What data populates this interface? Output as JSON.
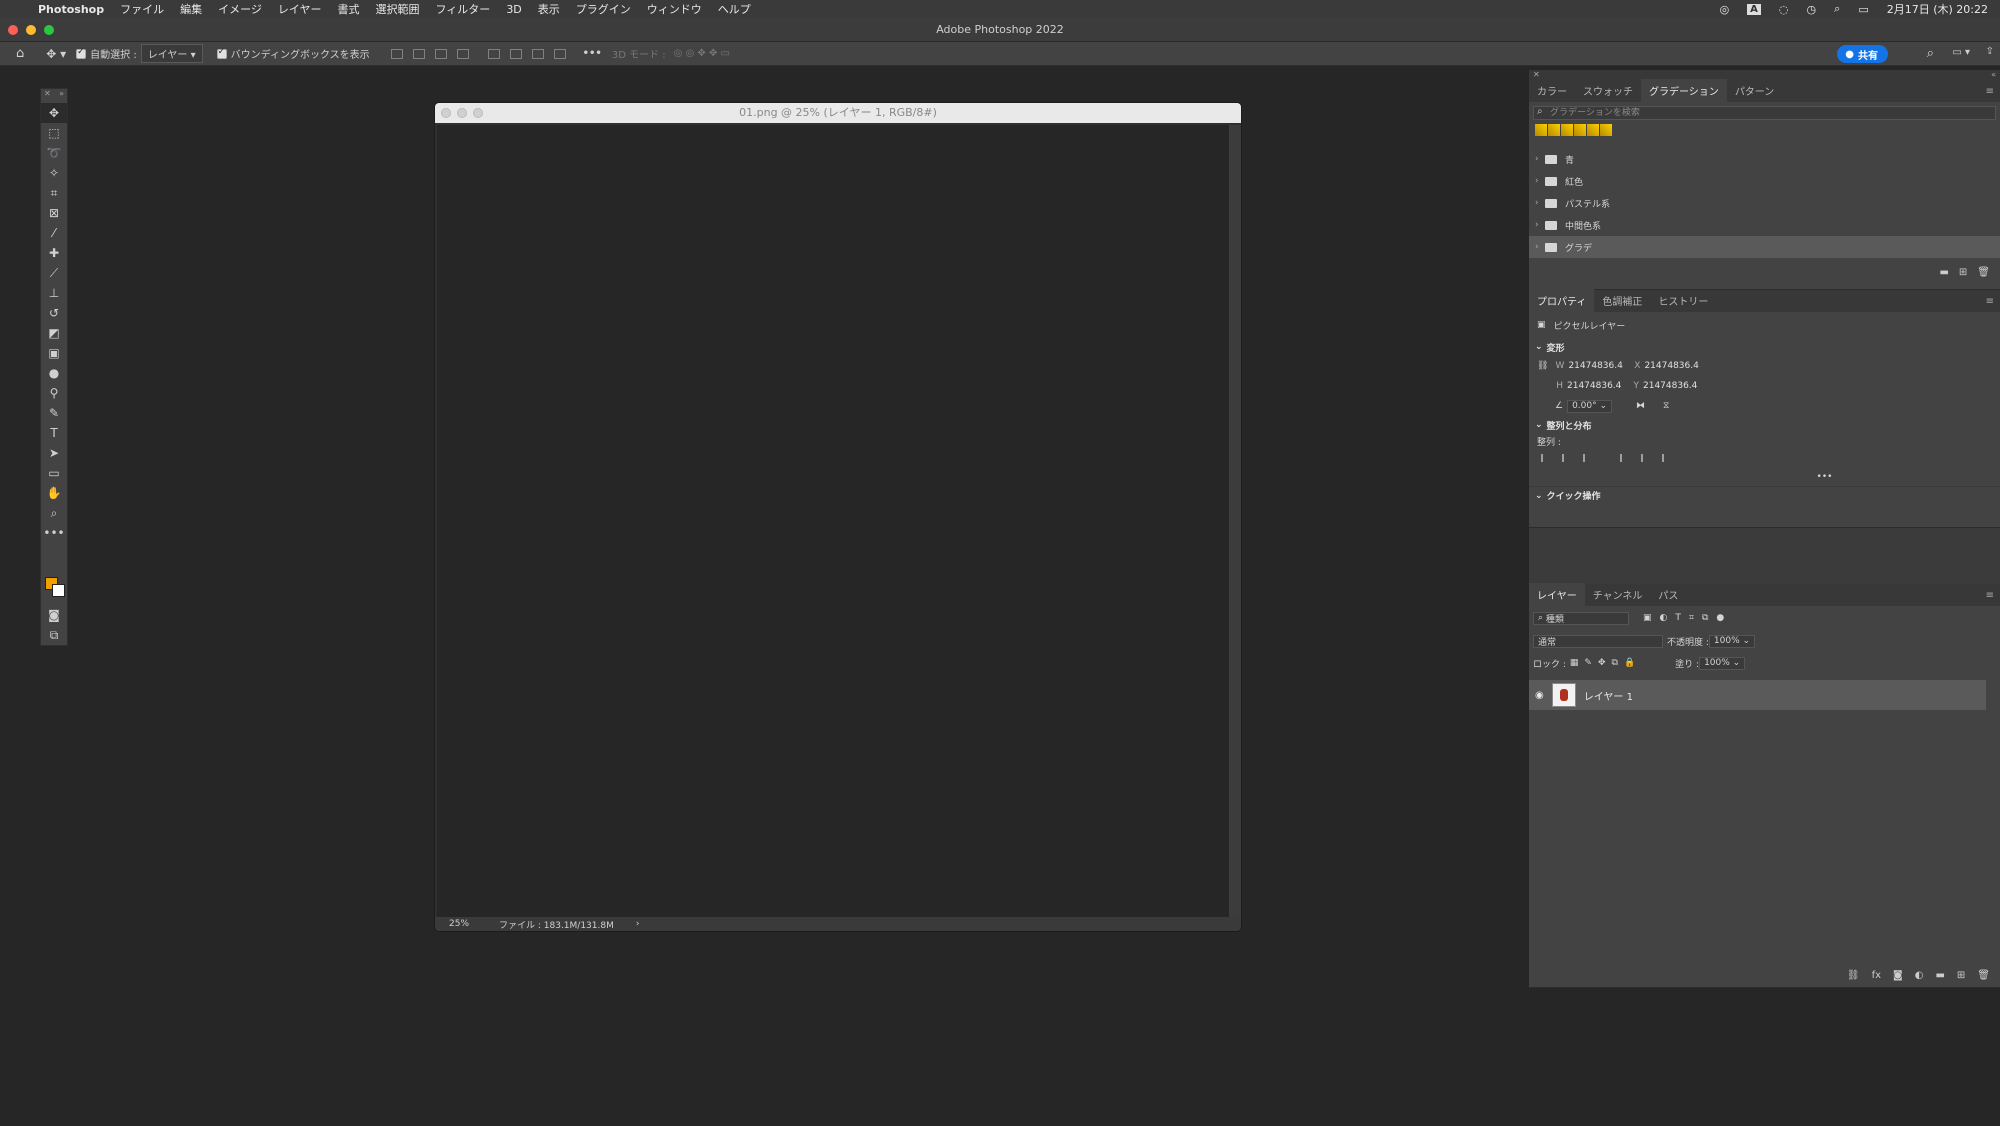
{
  "menubar": {
    "app_name": "Photoshop",
    "items": [
      "ファイル",
      "編集",
      "イメージ",
      "レイヤー",
      "書式",
      "選択範囲",
      "フィルター",
      "3D",
      "表示",
      "プラグイン",
      "ウィンドウ",
      "ヘルプ"
    ],
    "clock": "2月17日 (木)  20:22",
    "input_mode": "A"
  },
  "window": {
    "title": "Adobe Photoshop 2022"
  },
  "options_bar": {
    "auto_select_label": "自動選択 :",
    "auto_select_target": "レイヤー",
    "bounding_box_label": "バウンディングボックスを表示",
    "mode_3d_label": "3D モード :",
    "share_label": "共有"
  },
  "document": {
    "title": "01.png @ 25% (レイヤー 1, RGB/8#)",
    "zoom": "25%",
    "file_info": "ファイル : 183.1M/131.8M"
  },
  "gradient_panel": {
    "tabs": [
      "カラー",
      "スウォッチ",
      "グラデーション",
      "パターン"
    ],
    "active_tab": "グラデーション",
    "search_placeholder": "グラデーションを検索",
    "folders": [
      "青",
      "紅色",
      "パステル系",
      "中間色系",
      "グラデ"
    ],
    "selected_folder": "グラデ"
  },
  "properties_panel": {
    "tabs": [
      "プロパティ",
      "色調補正",
      "ヒストリー"
    ],
    "layer_type": "ピクセルレイヤー",
    "transform_label": "変形",
    "w_label": "W",
    "h_label": "H",
    "x_label": "X",
    "y_label": "Y",
    "w_value": "21474836.4",
    "h_value": "21474836.4",
    "x_value": "21474836.4",
    "y_value": "21474836.4",
    "angle_value": "0.00°",
    "align_section": "整列と分布",
    "align_label": "整列 :",
    "more": "•••",
    "quick_actions": "クイック操作"
  },
  "layers_panel": {
    "tabs": [
      "レイヤー",
      "チャンネル",
      "パス"
    ],
    "filter_kind": "種類",
    "blend_mode": "通常",
    "opacity_label": "不透明度 :",
    "opacity_value": "100%",
    "lock_label": "ロック :",
    "fill_label": "塗り :",
    "fill_value": "100%",
    "layer_name": "レイヤー 1"
  },
  "colors": {
    "foreground": "#f0a000",
    "background": "#ffffff",
    "accent": "#1473e6"
  }
}
